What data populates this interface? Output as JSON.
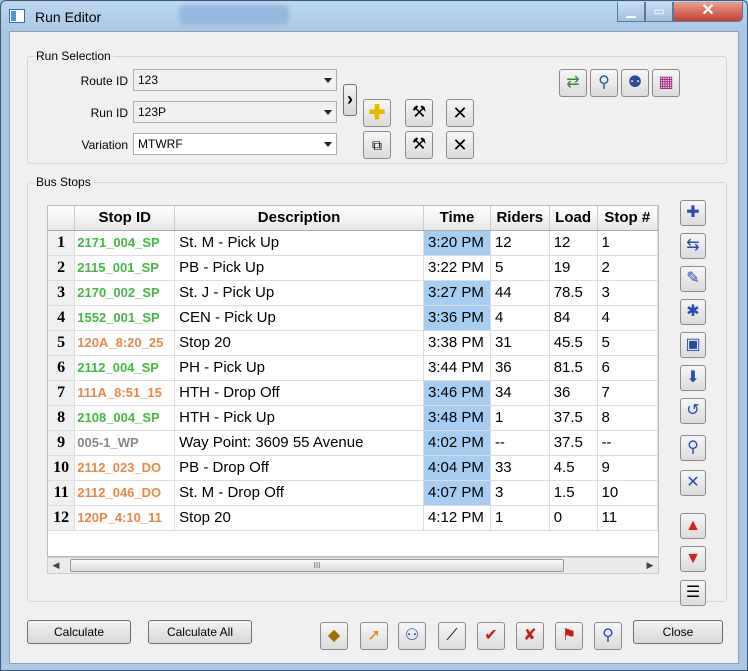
{
  "window": {
    "title": "Run Editor",
    "minimize_icon": "minimize-icon",
    "maximize_icon": "maximize-icon",
    "close_icon": "close-icon"
  },
  "run_selection": {
    "group_label": "Run Selection",
    "route_label": "Route ID",
    "route_value": "123",
    "run_label": "Run ID",
    "run_value": "123P",
    "variation_label": "Variation",
    "variation_value": "MTWRF",
    "expand_glyph": "›",
    "icons": [
      "add-icon",
      "copy-icon",
      "edit-hammer-icon",
      "edit-hammer-icon",
      "delete-x-icon",
      "delete-x-icon",
      "map-route-icon",
      "zoom-icon",
      "find-person-icon",
      "schedule-grid-icon"
    ]
  },
  "bus_stops": {
    "group_label": "Bus Stops",
    "columns": [
      "Stop ID",
      "Description",
      "Time",
      "Riders",
      "Load",
      "Stop #"
    ],
    "rows": [
      {
        "num": "1",
        "stop_id": "2171_004_SP",
        "color": "green",
        "description": "St. M - Pick Up",
        "time": "3:20 PM",
        "time_hl": true,
        "riders": "12",
        "load": "12",
        "stop_no": "1"
      },
      {
        "num": "2",
        "stop_id": "2115_001_SP",
        "color": "green",
        "description": "PB - Pick Up",
        "time": "3:22 PM",
        "time_hl": false,
        "riders": "5",
        "load": "19",
        "stop_no": "2"
      },
      {
        "num": "3",
        "stop_id": "2170_002_SP",
        "color": "green",
        "description": "St. J - Pick Up",
        "time": "3:27 PM",
        "time_hl": true,
        "riders": "44",
        "load": "78.5",
        "stop_no": "3"
      },
      {
        "num": "4",
        "stop_id": "1552_001_SP",
        "color": "green",
        "description": "CEN - Pick Up",
        "time": "3:36 PM",
        "time_hl": true,
        "riders": "4",
        "load": "84",
        "stop_no": "4"
      },
      {
        "num": "5",
        "stop_id": "120A_8:20_25",
        "color": "orange",
        "description": "Stop 20",
        "time": "3:38 PM",
        "time_hl": false,
        "riders": "31",
        "load": "45.5",
        "stop_no": "5"
      },
      {
        "num": "6",
        "stop_id": "2112_004_SP",
        "color": "green",
        "description": "PH - Pick Up",
        "time": "3:44 PM",
        "time_hl": false,
        "riders": "36",
        "load": "81.5",
        "stop_no": "6"
      },
      {
        "num": "7",
        "stop_id": "111A_8:51_15",
        "color": "orange",
        "description": "HTH - Drop Off",
        "time": "3:46 PM",
        "time_hl": true,
        "riders": "34",
        "load": "36",
        "stop_no": "7"
      },
      {
        "num": "8",
        "stop_id": "2108_004_SP",
        "color": "green",
        "description": "HTH - Pick Up",
        "time": "3:48 PM",
        "time_hl": true,
        "riders": "1",
        "load": "37.5",
        "stop_no": "8"
      },
      {
        "num": "9",
        "stop_id": "005-1_WP",
        "color": "gray",
        "description": "Way Point: 3609 55 Avenue",
        "time": "4:02 PM",
        "time_hl": true,
        "riders": "--",
        "load": "37.5",
        "stop_no": "--"
      },
      {
        "num": "10",
        "stop_id": "2112_023_DO",
        "color": "orange",
        "description": "PB - Drop Off",
        "time": "4:04 PM",
        "time_hl": true,
        "riders": "33",
        "load": "4.5",
        "stop_no": "9"
      },
      {
        "num": "11",
        "stop_id": "2112_046_DO",
        "color": "orange",
        "description": "St. M - Drop Off",
        "time": "4:07 PM",
        "time_hl": true,
        "riders": "3",
        "load": "1.5",
        "stop_no": "10"
      },
      {
        "num": "12",
        "stop_id": "120P_4:10_11",
        "color": "orange",
        "description": "Stop 20",
        "time": "4:12 PM",
        "time_hl": false,
        "riders": "1",
        "load": "0",
        "stop_no": "11"
      }
    ],
    "side_icons": [
      "add-stop-icon",
      "swap-stop-icon",
      "edit-stop-icon",
      "insert-stop-icon",
      "copy-stop-icon",
      "stop-down-icon",
      "stop-loop-icon",
      "stop-pin-icon",
      "remove-stop-icon",
      "move-up-icon",
      "move-down-icon",
      "reverse-icon"
    ],
    "scroll_grip": "III"
  },
  "footer": {
    "calculate_label": "Calculate",
    "calculate_all_label": "Calculate All",
    "close_label": "Close",
    "tool_icons": [
      "optimize-icon",
      "navigate-icon",
      "riders-icon",
      "wand-icon",
      "student-pin-icon",
      "student-edit-icon",
      "student-map-icon",
      "student-search-icon"
    ]
  },
  "colors": {
    "green_stop": "#44b844",
    "orange_stop": "#e8884a",
    "waypoint": "#888888",
    "time_highlight": "#a6cdf2"
  }
}
